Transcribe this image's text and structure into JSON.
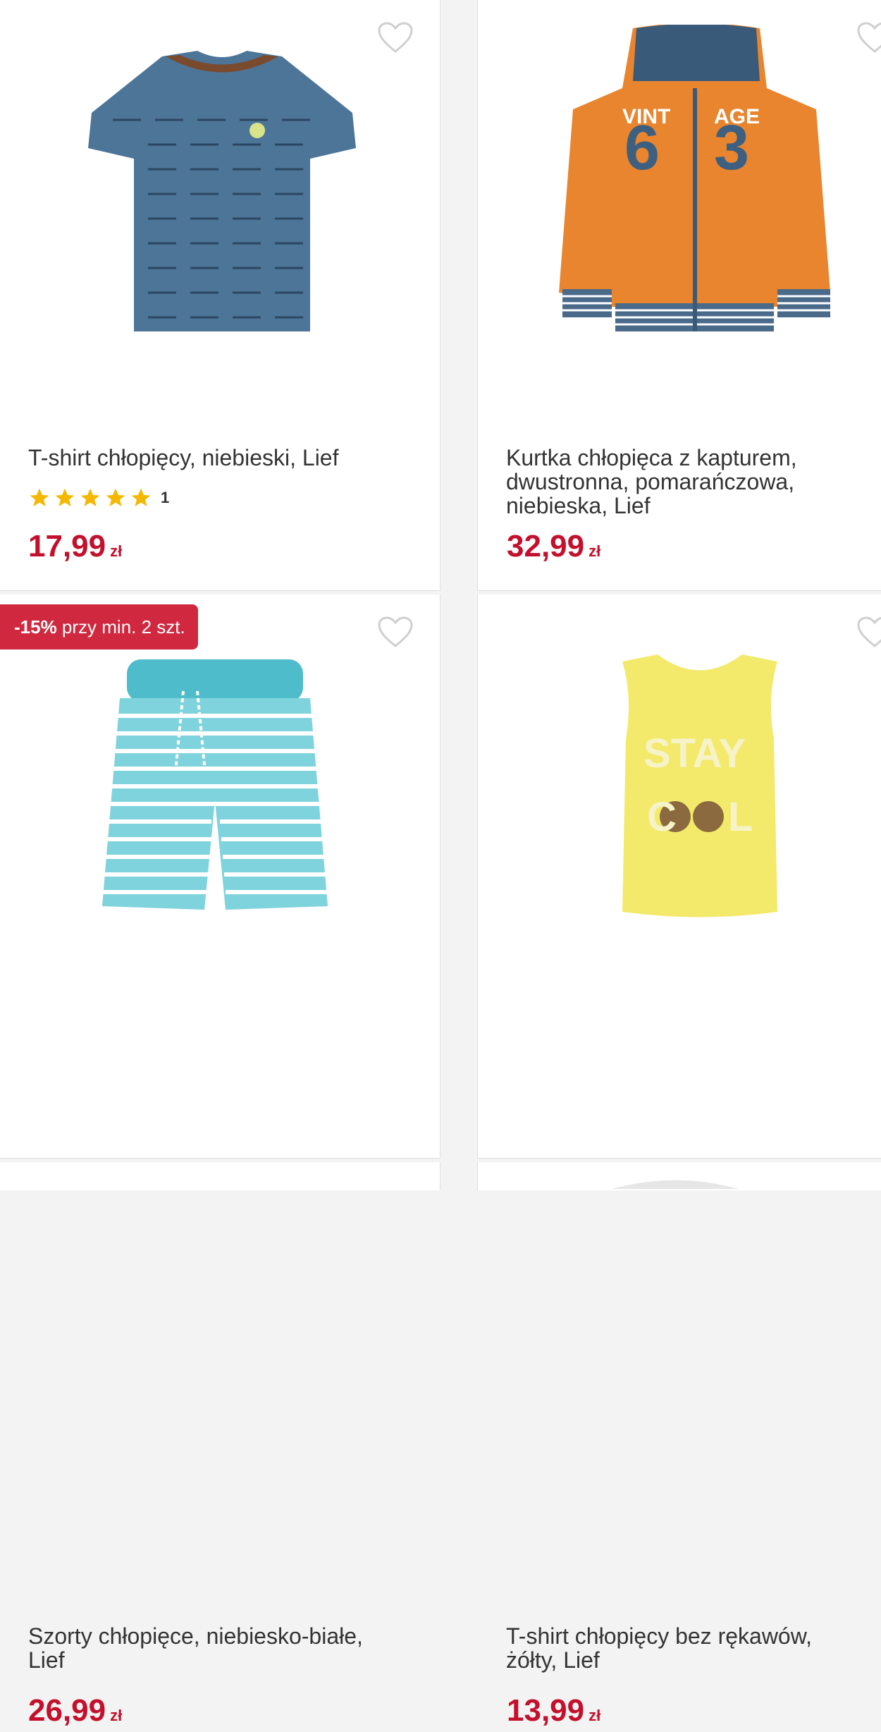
{
  "products": [
    {
      "title": "T-shirt chłopięcy, niebieski, Lief",
      "price": "17,99",
      "currency": "zł",
      "rating_stars": 5,
      "rating_count": "1",
      "image": "blue-tshirt-cars"
    },
    {
      "title_lines": [
        "Kurtka chłopięca z kapturem,",
        "dwustronna, pomarańczowa,",
        "niebieska, Lief"
      ],
      "price": "32,99",
      "currency": "zł",
      "image": "orange-hoodie-63"
    },
    {
      "title_lines": [
        "Szorty chłopięce, niebiesko-białe,",
        "Lief"
      ],
      "price": "26,99",
      "currency": "zł",
      "badge_bold": "-15%",
      "badge_text": " przy min. 2 szt.",
      "image": "striped-shorts"
    },
    {
      "title_lines": [
        "T-shirt chłopięcy bez rękawów,",
        "żółty, Lief"
      ],
      "price": "13,99",
      "currency": "zł",
      "image": "yellow-tank-stay-cool"
    }
  ],
  "colors": {
    "price": "#c3102c",
    "badge": "#d0283f",
    "heart": "#cfcfcf",
    "star": "#f5b800"
  }
}
